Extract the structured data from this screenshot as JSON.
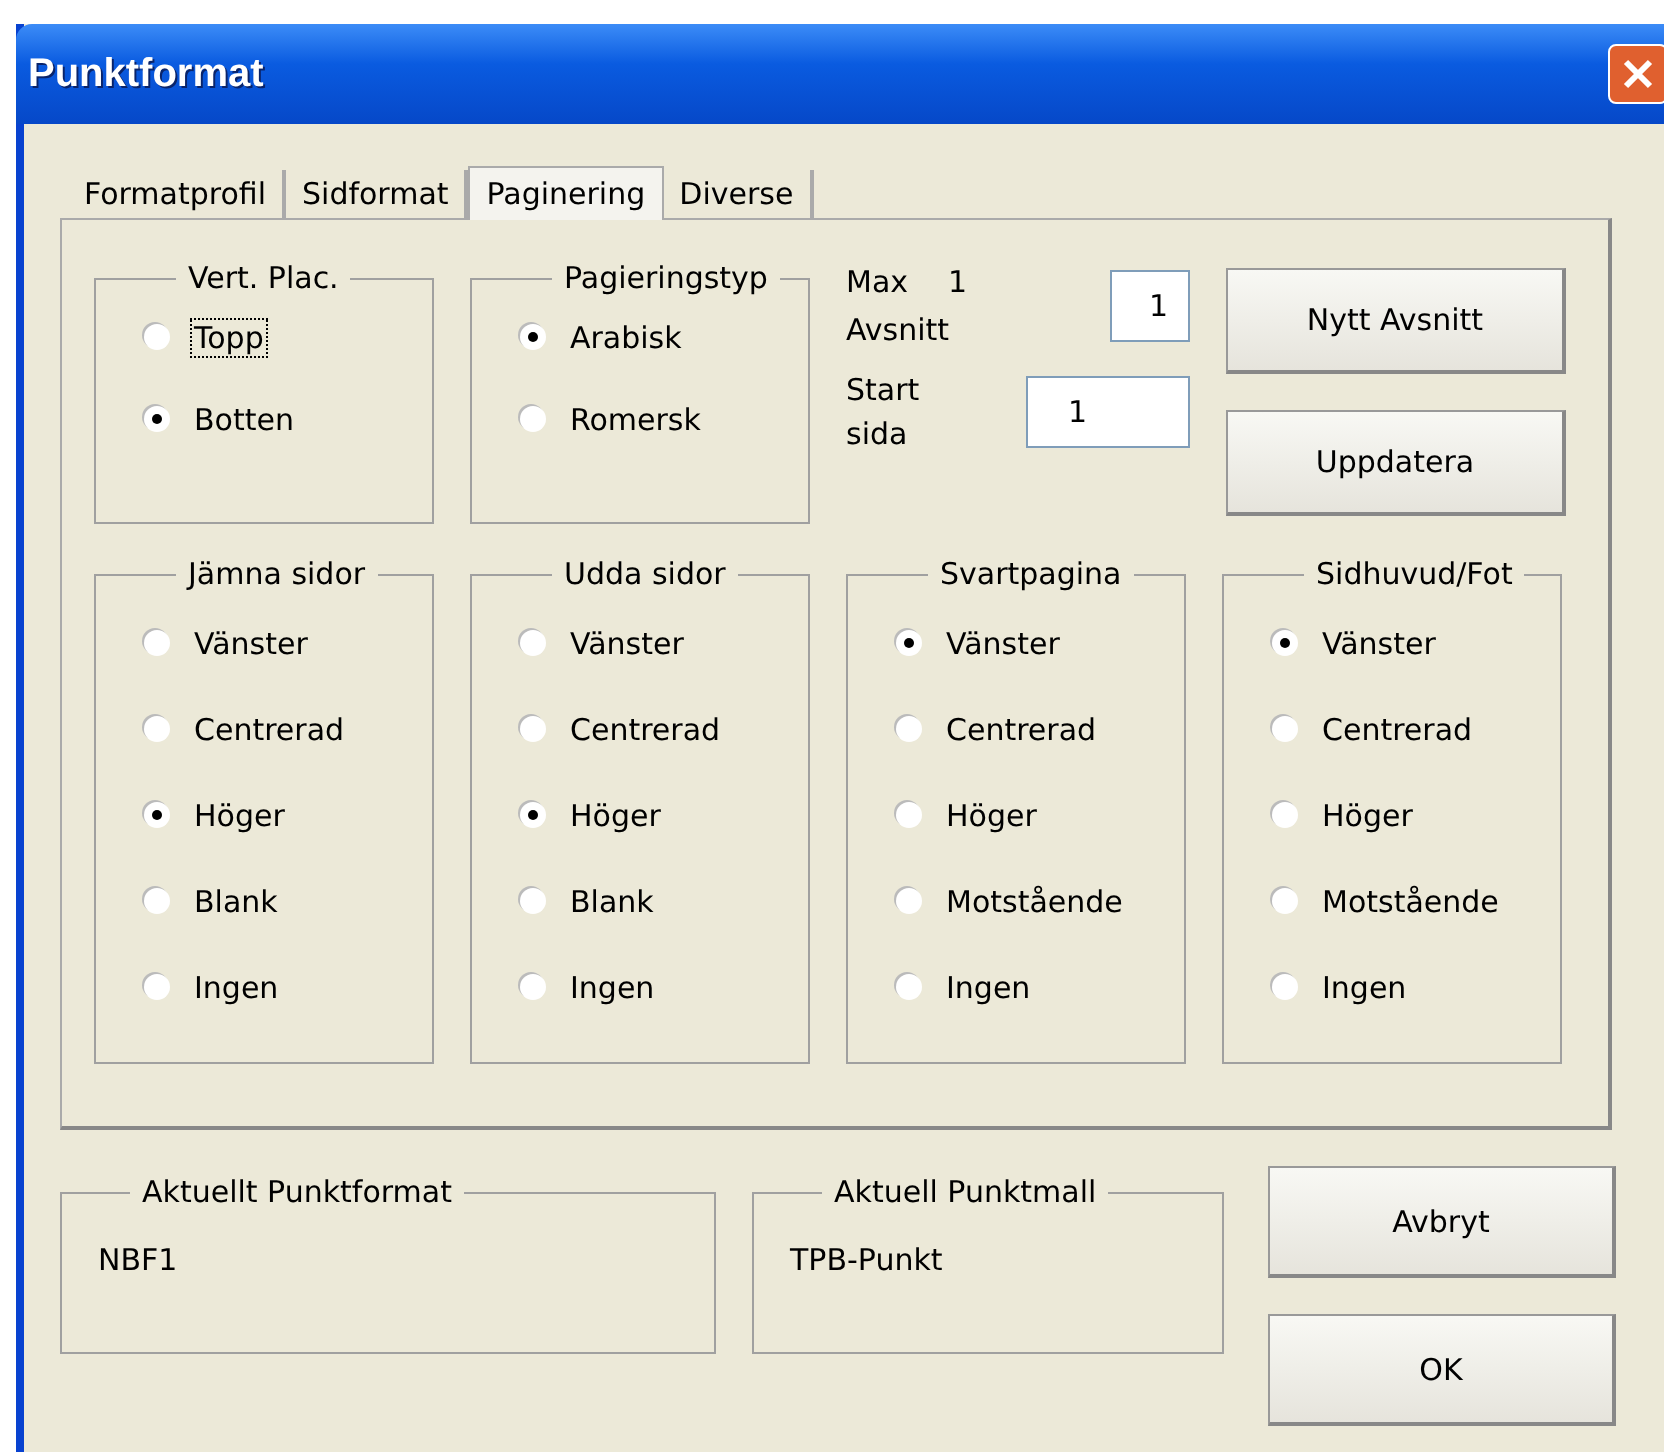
{
  "window": {
    "title": "Punktformat"
  },
  "tabs": [
    {
      "label": "Formatprofil",
      "selected": false
    },
    {
      "label": "Sidformat",
      "selected": false
    },
    {
      "label": "Paginering",
      "selected": true
    },
    {
      "label": "Diverse",
      "selected": false
    }
  ],
  "top_groups": [
    {
      "legend": "Vert. Plac.",
      "options": [
        {
          "label": "Topp",
          "selected": false,
          "focused": true
        },
        {
          "label": "Botten",
          "selected": true,
          "focused": false
        }
      ]
    },
    {
      "legend": "Pagieringstyp",
      "options": [
        {
          "label": "Arabisk",
          "selected": true,
          "focused": false
        },
        {
          "label": "Romersk",
          "selected": false,
          "focused": false
        }
      ]
    }
  ],
  "sections": {
    "max_label": "Max",
    "max_count": "1",
    "max_label_2": "Avsnitt",
    "max_field": "1",
    "start_label": "Start sida",
    "start_field": "1"
  },
  "side_buttons": [
    "Nytt Avsnitt",
    "Uppdatera"
  ],
  "groups": [
    {
      "legend": "Jämna sidor",
      "options": [
        {
          "label": "Vänster",
          "selected": false
        },
        {
          "label": "Centrerad",
          "selected": false
        },
        {
          "label": "Höger",
          "selected": true
        },
        {
          "label": "Blank",
          "selected": false
        },
        {
          "label": "Ingen",
          "selected": false
        }
      ]
    },
    {
      "legend": "Udda sidor",
      "options": [
        {
          "label": "Vänster",
          "selected": false
        },
        {
          "label": "Centrerad",
          "selected": false
        },
        {
          "label": "Höger",
          "selected": true
        },
        {
          "label": "Blank",
          "selected": false
        },
        {
          "label": "Ingen",
          "selected": false
        }
      ]
    },
    {
      "legend": "Svartpagina",
      "options": [
        {
          "label": "Vänster",
          "selected": true
        },
        {
          "label": "Centrerad",
          "selected": false
        },
        {
          "label": "Höger",
          "selected": false
        },
        {
          "label": "Motstående",
          "selected": false
        },
        {
          "label": "Ingen",
          "selected": false
        }
      ]
    },
    {
      "legend": "Sidhuvud/Fot",
      "options": [
        {
          "label": "Vänster",
          "selected": true
        },
        {
          "label": "Centrerad",
          "selected": false
        },
        {
          "label": "Höger",
          "selected": false
        },
        {
          "label": "Motstående",
          "selected": false
        },
        {
          "label": "Ingen",
          "selected": false
        }
      ]
    }
  ],
  "info": [
    {
      "legend": "Aktuellt Punktformat",
      "value": "NBF1"
    },
    {
      "legend": "Aktuell Punktmall",
      "value": "TPB-Punkt"
    }
  ],
  "buttons": [
    "Avbryt",
    "OK"
  ]
}
